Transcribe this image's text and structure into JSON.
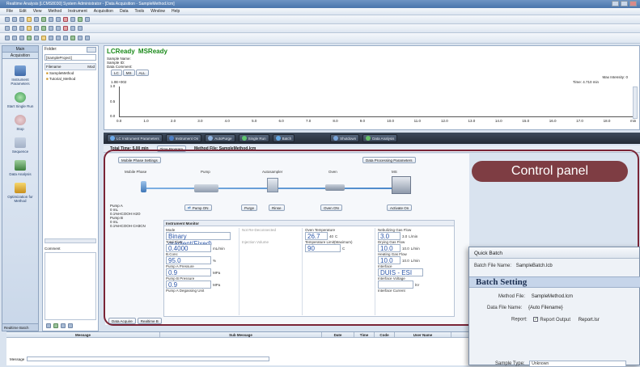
{
  "window": {
    "title": "Realtime Analysis [LCMS8030] System Administrator - [Data Acquisition - SampleMethod.lcm]"
  },
  "menu": [
    "File",
    "Edit",
    "View",
    "Method",
    "Instrument",
    "Acquisition",
    "Data",
    "Tools",
    "Window",
    "Help"
  ],
  "nav": {
    "header_main": "Main",
    "header_acq": "Acquisition",
    "items": [
      "Instrument Parameters",
      "Start Single Run",
      "Stop",
      "Sequence",
      "Data Analysis",
      "Optimization for Method"
    ],
    "footer_tab": "Realtime Batch"
  },
  "file_explorer": {
    "folder_label": "Folder:",
    "folder_value": "[SampleProject]",
    "col_filename": "Filename",
    "col_mod": "Mod",
    "files": [
      "SampleMethod",
      "Tutorial_Method"
    ],
    "comment_label": "Comment"
  },
  "graph": {
    "lc_status": "LCReady",
    "ms_status": "MSReady",
    "info": [
      "Sample Name:",
      "Sample ID:",
      "Data Comment:"
    ],
    "tabs": [
      "LC",
      "MS",
      "ALL"
    ],
    "ymax": "1.0E+002",
    "right_label": "Max Intensity: 0",
    "time_label": "Time: 4.710 min",
    "x_ticks": [
      "0.0",
      "1.0",
      "2.0",
      "3.0",
      "4.0",
      "5.0",
      "6.0",
      "7.0",
      "8.0",
      "9.0",
      "10.0",
      "11.0",
      "12.0",
      "13.0",
      "14.0",
      "15.0",
      "16.0",
      "17.0",
      "18.0",
      "min"
    ],
    "y_ticks": [
      "1.0",
      "0.5",
      "0.0"
    ]
  },
  "controls": {
    "buttons": [
      "LC Instrument Parameters",
      "Instrument On",
      "AutoPurge",
      "Single Run",
      "Batch",
      "Shutdown",
      "Data Analysis"
    ]
  },
  "status_strip": {
    "total_time": "Total Time: 5.00 min",
    "time_program": "Time Program",
    "method_file": "Method File:  SampleMethod.lcm"
  },
  "flow": {
    "top_buttons": {
      "mobile_phase_settings": "Mobile Phase Settings",
      "data_processing": "Data Processing Parameters"
    },
    "units": [
      "Mobile Phase",
      "Pump",
      "Autosampler",
      "Oven",
      "MS"
    ],
    "actions": [
      "Pump ON",
      "Purge",
      "Rinse",
      "Oven ON",
      "Activate On"
    ],
    "pump_a": "Pump A",
    "pump_b": "Pump B",
    "solvent_a": "0.1%HCOOH H2O",
    "solvent_b": "0.1%HCOOH CH3CN",
    "vol_a": "0",
    "vol_b": "0",
    "unit": "mL"
  },
  "monitor": {
    "title": "Instrument Monitor",
    "mode_label": "Mode",
    "mode_value": "Binary gradient(Fixed)",
    "total_flow_label": "Total Flow",
    "total_flow": "0.4000",
    "total_flow_unit": "mL/min",
    "bconc_label": "B.Conc",
    "bconc": "95.0",
    "bconc_unit": "%",
    "pump_a_press_label": "Pump A Pressure",
    "pump_a_press": "0.9",
    "press_unit": "MPa",
    "pump_b_press_label": "Pump B Pressure",
    "pump_b_press": "0.9",
    "pump_a_degas": "Pump A Degassing Unit"
  },
  "autosampler_col": {
    "label1": "Not Re-Deconnected",
    "label2": "Injection Volume"
  },
  "oven": {
    "label": "Oven Temperature",
    "value": "26.7",
    "set": "40",
    "unit": "C",
    "label2": "Temperature Limit(Maximum)",
    "value2": "90",
    "unit2": "C"
  },
  "ms": {
    "neb_label": "Nebulizing Gas Flow",
    "neb": "3.0",
    "neb_set": "3.0",
    "drying_label": "Drying Gas Flow",
    "drying": "10.0",
    "drying_set": "10.0",
    "heat_label": "Heating Gas Flow",
    "heat": "10.0",
    "heat_set": "10.0",
    "iface_label": "Interface",
    "iface": "DUIS - ESI",
    "voltage_label": "Interface Voltage",
    "current_label": "Interface Current",
    "flow_unit": "L/min",
    "kv": "kV"
  },
  "panel_tabs": [
    "Data Acquire",
    "Realtime B"
  ],
  "callout": "Control panel",
  "message_grid": {
    "cols": [
      "Message",
      "Sub Message",
      "Date",
      "Time",
      "Code",
      "User Name"
    ],
    "bottom_label": "Message"
  },
  "quick_batch": {
    "title": "Quick Batch",
    "batch_file_label": "Batch File Name:",
    "batch_file": "SampleBatch.lcb",
    "section": "Batch Setting",
    "method_label": "Method File:",
    "method": "SampleMethod.lcm",
    "data_label": "Data File Name:",
    "data": "{Auto Filename}",
    "report_label": "Report:",
    "report_check": "Report Output",
    "report_file": "Report.lsr",
    "sample_type_label": "Sample Type:",
    "sample_type": "Unknown"
  }
}
